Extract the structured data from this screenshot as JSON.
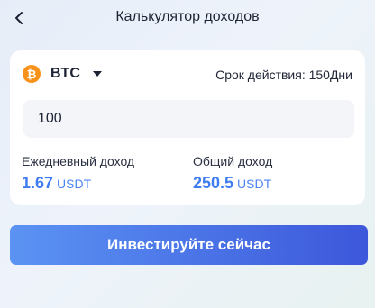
{
  "header": {
    "title": "Калькулятор доходов"
  },
  "card": {
    "coin": {
      "symbol": "BTC",
      "icon_glyph": "₿",
      "icon_color": "#f7931a"
    },
    "term_text": "Срок действия: 150Дни",
    "amount_input": {
      "value": "100"
    },
    "daily": {
      "label": "Ежедневный доход",
      "value": "1.67",
      "unit": "USDT"
    },
    "total": {
      "label": "Общий доход",
      "value": "250.5",
      "unit": "USDT"
    }
  },
  "invest_button": {
    "label": "Инвестируйте сейчас"
  },
  "colors": {
    "accent": "#3f7cf2",
    "button_start": "#5b93f3",
    "button_end": "#3d57db"
  }
}
